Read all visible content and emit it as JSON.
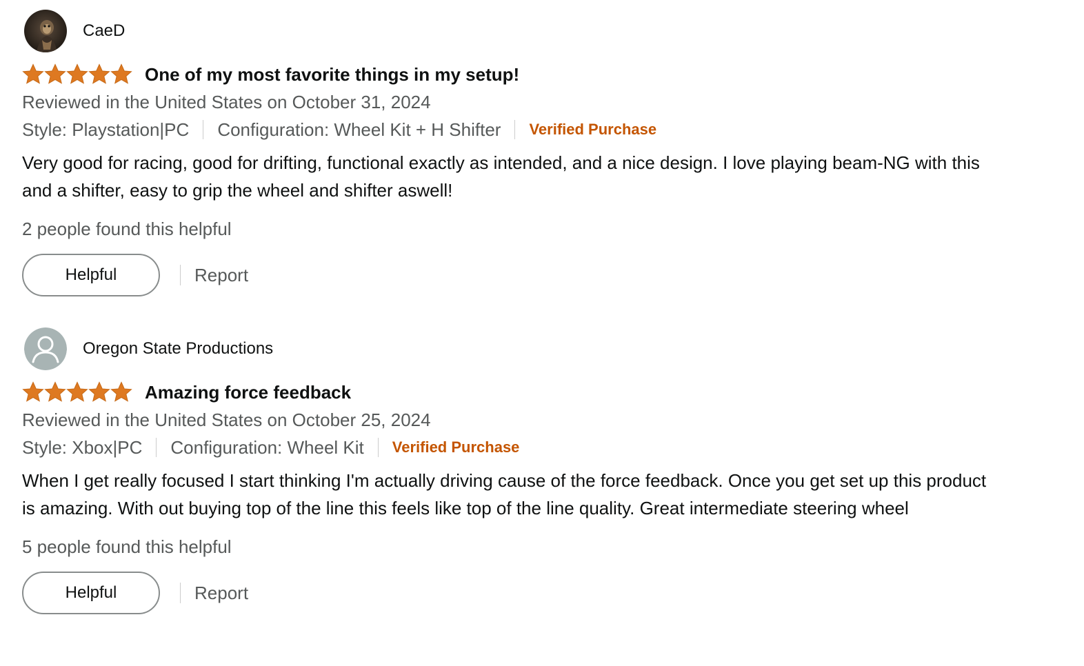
{
  "colors": {
    "star": "#de7921",
    "verified": "#c45500",
    "muted_text": "#565959"
  },
  "reviews": [
    {
      "reviewer": "CaeD",
      "avatar": "profile-photo",
      "rating": 5,
      "title": "One of my most favorite things in my setup!",
      "date": "Reviewed in the United States on October 31, 2024",
      "style": "Style: Playstation|PC",
      "configuration": "Configuration: Wheel Kit + H Shifter",
      "verified": "Verified Purchase",
      "body": "Very good for racing, good for drifting, functional exactly as intended, and a nice design. I love playing beam-NG with this and a shifter, easy to grip the wheel and shifter aswell!",
      "helpful_count": "2 people found this helpful",
      "helpful_label": "Helpful",
      "report_label": "Report"
    },
    {
      "reviewer": "Oregon State Productions",
      "avatar": "default-user-icon",
      "rating": 5,
      "title": "Amazing force feedback",
      "date": "Reviewed in the United States on October 25, 2024",
      "style": "Style: Xbox|PC",
      "configuration": "Configuration: Wheel Kit",
      "verified": "Verified Purchase",
      "body": "When I get really focused I start thinking I'm actually driving cause of the force feedback. Once you get set up this product is amazing. With out buying top of the line this feels like top of the line quality. Great intermediate steering wheel",
      "helpful_count": "5 people found this helpful",
      "helpful_label": "Helpful",
      "report_label": "Report"
    }
  ]
}
